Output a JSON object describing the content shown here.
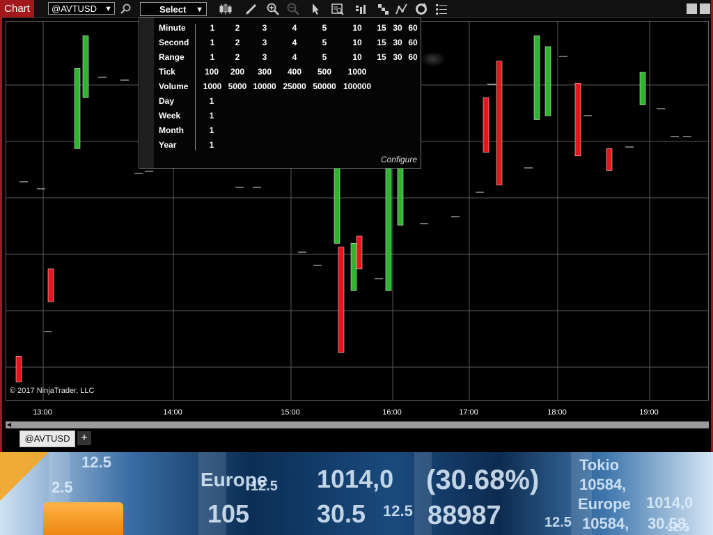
{
  "toolbar": {
    "chart_label": "Chart",
    "instrument": "@AVTUSD",
    "period_select": "Select",
    "icons": [
      "search-icon",
      "candlestick-style-icon",
      "draw-pencil-icon",
      "zoom-in-icon",
      "zoom-out-icon",
      "pointer-icon",
      "data-box-icon",
      "bar-type-icon",
      "order-ladder-icon",
      "indicators-icon",
      "reload-icon",
      "properties-icon"
    ]
  },
  "interval_menu": {
    "rows": [
      {
        "label": "Minute",
        "values": [
          "1",
          "2",
          "3",
          "4",
          "5",
          "10",
          "15",
          "30",
          "60"
        ]
      },
      {
        "label": "Second",
        "values": [
          "1",
          "2",
          "3",
          "4",
          "5",
          "10",
          "15",
          "30",
          "60"
        ]
      },
      {
        "label": "Range",
        "values": [
          "1",
          "2",
          "3",
          "4",
          "5",
          "10",
          "15",
          "30",
          "60"
        ]
      },
      {
        "label": "Tick",
        "values": [
          "100",
          "200",
          "300",
          "400",
          "500",
          "1000"
        ]
      },
      {
        "label": "Volume",
        "values": [
          "1000",
          "5000",
          "10000",
          "25000",
          "50000",
          "100000"
        ]
      },
      {
        "label": "Day",
        "values": [
          "1"
        ]
      },
      {
        "label": "Week",
        "values": [
          "1"
        ]
      },
      {
        "label": "Month",
        "values": [
          "1"
        ]
      },
      {
        "label": "Year",
        "values": [
          "1"
        ]
      }
    ],
    "configure": "Configure"
  },
  "chart": {
    "x_labels": [
      "13:00",
      "14:00",
      "15:00",
      "16:00",
      "17:00",
      "18:00",
      "19:00"
    ],
    "copyright": "© 2017 NinjaTrader, LLC",
    "up_color": "#2db52d",
    "down_color": "#e8141b"
  },
  "tabs": [
    {
      "label": "@AVTUSD"
    }
  ],
  "banner": {
    "texts": [
      "12.5",
      "2.5",
      "Europe",
      "12.5",
      "105",
      "1014,0",
      "30.5",
      "12.5",
      "(30.68%)",
      "88987",
      "12.5",
      "Tokio",
      "10584,",
      "Europe",
      "10584,",
      "1014,0",
      "30.58,",
      "12.5"
    ]
  },
  "chart_data": {
    "type": "candlestick",
    "x_labels": [
      "13:00",
      "14:00",
      "15:00",
      "16:00",
      "17:00",
      "18:00",
      "19:00"
    ],
    "candles": [
      {
        "dir": "down",
        "open": 0.11,
        "close": 0.04
      },
      {
        "dir": "down",
        "open": 0.35,
        "close": 0.26
      },
      {
        "dir": "up",
        "open": 0.68,
        "close": 0.9
      },
      {
        "dir": "up",
        "open": 0.82,
        "close": 0.99
      },
      {
        "dir": "down",
        "open": 0.99,
        "close": 0.68
      },
      {
        "dir": "up",
        "open": 0.42,
        "close": 0.85
      },
      {
        "dir": "down",
        "open": 0.41,
        "close": 0.12
      },
      {
        "dir": "up",
        "open": 0.42,
        "close": 0.29
      },
      {
        "dir": "down",
        "open": 0.44,
        "close": 0.35
      },
      {
        "dir": "up",
        "open": 0.29,
        "close": 0.83
      },
      {
        "dir": "up",
        "open": 0.47,
        "close": 0.92
      },
      {
        "dir": "down",
        "open": 0.67,
        "close": 0.82
      },
      {
        "dir": "down",
        "open": 0.92,
        "close": 0.58
      },
      {
        "dir": "up",
        "open": 0.76,
        "close": 0.99
      },
      {
        "dir": "up",
        "open": 0.77,
        "close": 0.96
      },
      {
        "dir": "down",
        "open": 0.86,
        "close": 0.66
      },
      {
        "dir": "down",
        "open": 0.68,
        "close": 0.62
      },
      {
        "dir": "up",
        "open": 0.8,
        "close": 0.89
      }
    ]
  }
}
